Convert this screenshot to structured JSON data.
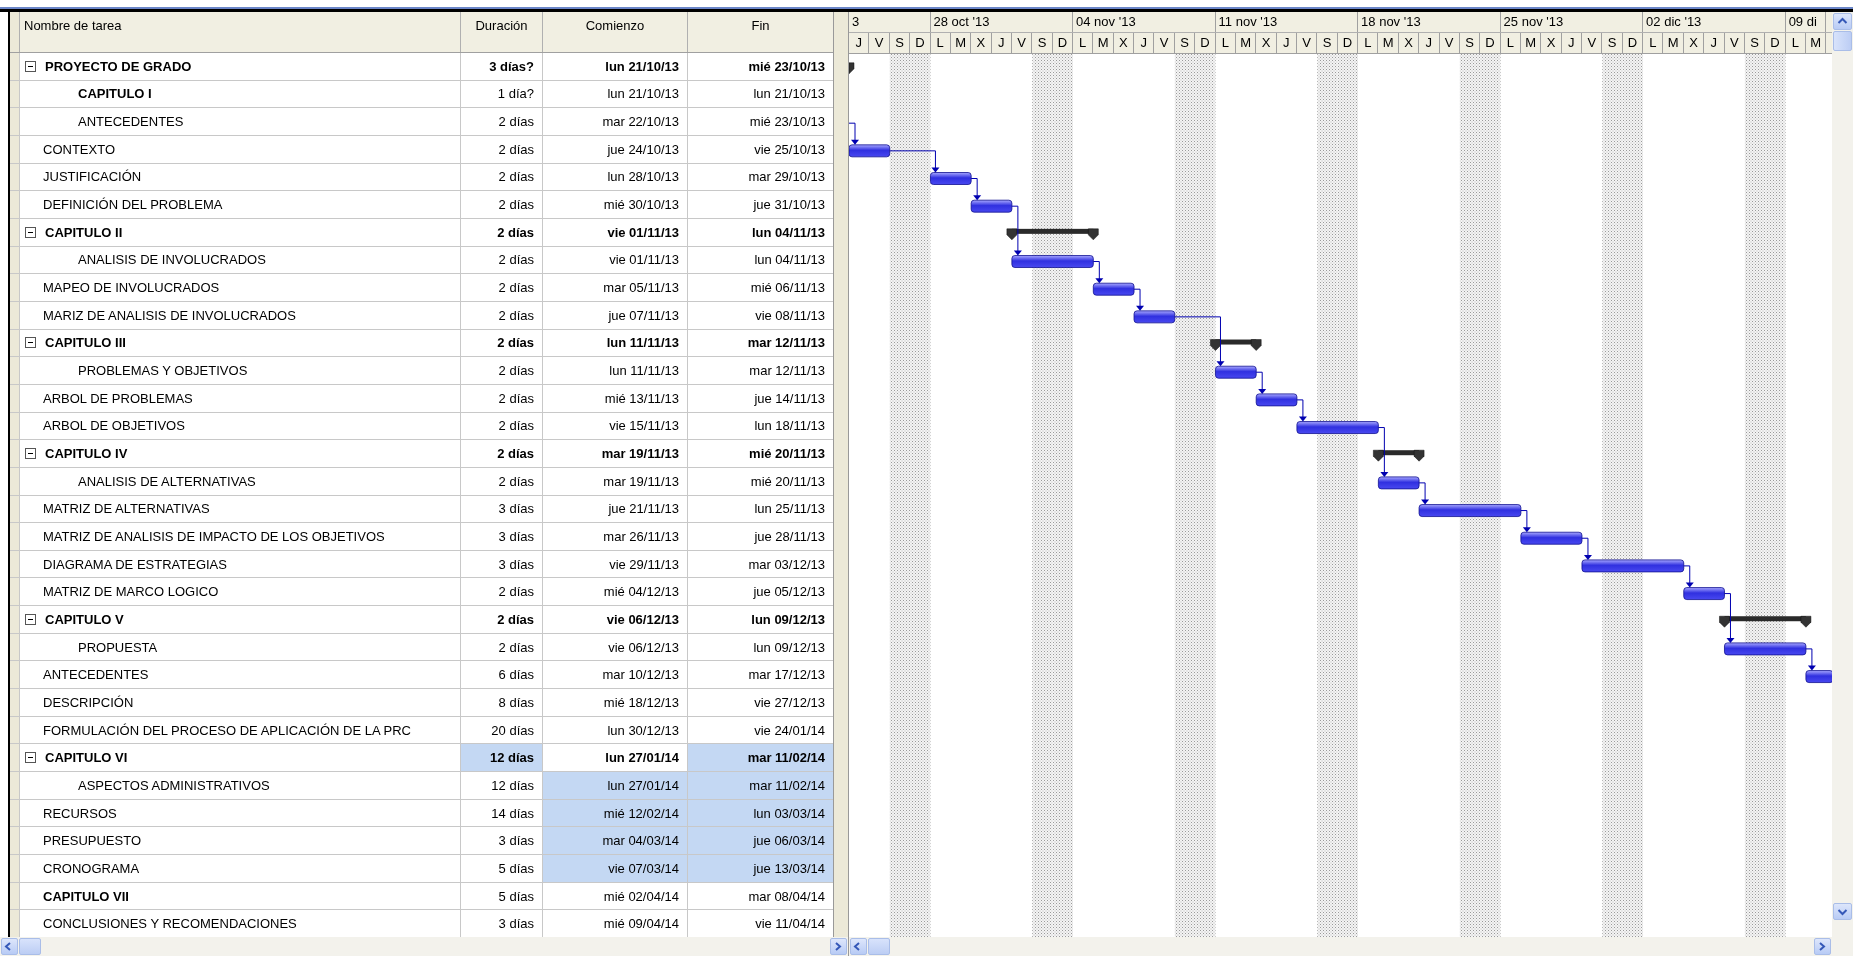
{
  "table": {
    "columns": [
      "Nombre de tarea",
      "Duración",
      "Comienzo",
      "Fin"
    ],
    "rows": [
      {
        "name": "PROYECTO DE GRADO",
        "kind": "summary",
        "expanded": true,
        "duration": "3 días?",
        "start": "lun 21/10/13",
        "finish": "mié 23/10/13",
        "predecessor_link": false,
        "duration_selected": false,
        "start_selected": false,
        "finish_selected": false,
        "children": [
          {
            "name": "CAPITULO I",
            "kind": "heading",
            "duration": "1 día?",
            "start": "lun 21/10/13",
            "finish": "lun 21/10/13",
            "predecessor_link": false,
            "duration_selected": false,
            "start_selected": false,
            "finish_selected": false
          },
          {
            "name": "ANTECEDENTES",
            "kind": "task",
            "duration": "2 días",
            "start": "mar 22/10/13",
            "finish": "mié 23/10/13",
            "predecessor_link": true,
            "duration_selected": false,
            "start_selected": false,
            "finish_selected": false
          }
        ]
      },
      {
        "name": "CONTEXTO",
        "kind": "task",
        "duration": "2 días",
        "start": "jue 24/10/13",
        "finish": "vie 25/10/13",
        "predecessor_link": true,
        "duration_selected": false,
        "start_selected": false,
        "finish_selected": false
      },
      {
        "name": "JUSTIFICACIÓN",
        "kind": "task",
        "duration": "2 días",
        "start": "lun 28/10/13",
        "finish": "mar 29/10/13",
        "predecessor_link": true,
        "duration_selected": false,
        "start_selected": false,
        "finish_selected": false
      },
      {
        "name": "DEFINICIÓN DEL PROBLEMA",
        "kind": "task",
        "duration": "2 días",
        "start": "mié 30/10/13",
        "finish": "jue 31/10/13",
        "predecessor_link": true,
        "duration_selected": false,
        "start_selected": false,
        "finish_selected": false
      },
      {
        "name": "CAPITULO II",
        "kind": "summary",
        "expanded": true,
        "duration": "2 días",
        "start": "vie 01/11/13",
        "finish": "lun 04/11/13",
        "predecessor_link": false,
        "duration_selected": false,
        "start_selected": false,
        "finish_selected": false,
        "children": [
          {
            "name": "ANALISIS DE INVOLUCRADOS",
            "kind": "task",
            "duration": "2 días",
            "start": "vie 01/11/13",
            "finish": "lun 04/11/13",
            "predecessor_link": true,
            "duration_selected": false,
            "start_selected": false,
            "finish_selected": false
          }
        ]
      },
      {
        "name": "MAPEO DE INVOLUCRADOS",
        "kind": "task",
        "duration": "2 días",
        "start": "mar 05/11/13",
        "finish": "mié 06/11/13",
        "predecessor_link": true,
        "duration_selected": false,
        "start_selected": false,
        "finish_selected": false
      },
      {
        "name": "MARIZ DE ANALISIS DE INVOLUCRADOS",
        "kind": "task",
        "duration": "2 días",
        "start": "jue 07/11/13",
        "finish": "vie 08/11/13",
        "predecessor_link": true,
        "duration_selected": false,
        "start_selected": false,
        "finish_selected": false
      },
      {
        "name": "CAPITULO III",
        "kind": "summary",
        "expanded": true,
        "duration": "2 días",
        "start": "lun 11/11/13",
        "finish": "mar 12/11/13",
        "predecessor_link": false,
        "duration_selected": false,
        "start_selected": false,
        "finish_selected": false,
        "children": [
          {
            "name": "PROBLEMAS Y OBJETIVOS",
            "kind": "task",
            "duration": "2 días",
            "start": "lun 11/11/13",
            "finish": "mar 12/11/13",
            "predecessor_link": true,
            "duration_selected": false,
            "start_selected": false,
            "finish_selected": false
          }
        ]
      },
      {
        "name": "ARBOL DE PROBLEMAS",
        "kind": "task",
        "duration": "2 días",
        "start": "mié 13/11/13",
        "finish": "jue 14/11/13",
        "predecessor_link": true,
        "duration_selected": false,
        "start_selected": false,
        "finish_selected": false
      },
      {
        "name": "ARBOL DE OBJETIVOS",
        "kind": "task",
        "duration": "2 días",
        "start": "vie 15/11/13",
        "finish": "lun 18/11/13",
        "predecessor_link": true,
        "duration_selected": false,
        "start_selected": false,
        "finish_selected": false
      },
      {
        "name": "CAPITULO IV",
        "kind": "summary",
        "expanded": true,
        "duration": "2 días",
        "start": "mar 19/11/13",
        "finish": "mié 20/11/13",
        "predecessor_link": false,
        "duration_selected": false,
        "start_selected": false,
        "finish_selected": false,
        "children": [
          {
            "name": "ANALISIS DE ALTERNATIVAS",
            "kind": "task",
            "duration": "2 días",
            "start": "mar 19/11/13",
            "finish": "mié 20/11/13",
            "predecessor_link": true,
            "duration_selected": false,
            "start_selected": false,
            "finish_selected": false
          }
        ]
      },
      {
        "name": "MATRIZ DE ALTERNATIVAS",
        "kind": "task",
        "duration": "3 días",
        "start": "jue 21/11/13",
        "finish": "lun 25/11/13",
        "predecessor_link": true,
        "duration_selected": false,
        "start_selected": false,
        "finish_selected": false
      },
      {
        "name": "MATRIZ DE ANALISIS DE IMPACTO DE LOS OBJETIVOS",
        "kind": "task",
        "duration": "3 días",
        "start": "mar 26/11/13",
        "finish": "jue 28/11/13",
        "predecessor_link": true,
        "duration_selected": false,
        "start_selected": false,
        "finish_selected": false
      },
      {
        "name": "DIAGRAMA DE ESTRATEGIAS",
        "kind": "task",
        "duration": "3 días",
        "start": "vie 29/11/13",
        "finish": "mar 03/12/13",
        "predecessor_link": true,
        "duration_selected": false,
        "start_selected": false,
        "finish_selected": false
      },
      {
        "name": "MATRIZ DE MARCO LOGICO",
        "kind": "task",
        "duration": "2 días",
        "start": "mié 04/12/13",
        "finish": "jue 05/12/13",
        "predecessor_link": true,
        "duration_selected": false,
        "start_selected": false,
        "finish_selected": false
      },
      {
        "name": "CAPITULO V",
        "kind": "summary",
        "expanded": true,
        "duration": "2 días",
        "start": "vie 06/12/13",
        "finish": "lun 09/12/13",
        "predecessor_link": false,
        "duration_selected": false,
        "start_selected": false,
        "finish_selected": false,
        "children": [
          {
            "name": "PROPUESTA",
            "kind": "task",
            "duration": "2 días",
            "start": "vie 06/12/13",
            "finish": "lun 09/12/13",
            "predecessor_link": true,
            "duration_selected": false,
            "start_selected": false,
            "finish_selected": false
          }
        ]
      },
      {
        "name": "ANTECEDENTES",
        "kind": "task",
        "duration": "6 días",
        "start": "mar 10/12/13",
        "finish": "mar 17/12/13",
        "predecessor_link": false,
        "duration_selected": false,
        "start_selected": false,
        "finish_selected": false
      },
      {
        "name": "DESCRIPCIÓN",
        "kind": "task",
        "duration": "8 días",
        "start": "mié 18/12/13",
        "finish": "vie 27/12/13",
        "predecessor_link": false,
        "duration_selected": false,
        "start_selected": false,
        "finish_selected": false
      },
      {
        "name": "FORMULACIÓN DEL PROCESO DE APLICACIÓN DE LA PRC",
        "kind": "task",
        "duration": "20 días",
        "start": "lun 30/12/13",
        "finish": "vie 24/01/14",
        "predecessor_link": false,
        "duration_selected": false,
        "start_selected": false,
        "finish_selected": false
      },
      {
        "name": "CAPITULO VI",
        "kind": "summary",
        "expanded": true,
        "duration": "12 días",
        "start": "lun 27/01/14",
        "finish": "mar 11/02/14",
        "predecessor_link": false,
        "duration_selected": true,
        "start_selected": false,
        "finish_selected": true,
        "children": [
          {
            "name": "ASPECTOS ADMINISTRATIVOS",
            "kind": "task",
            "duration": "12 días",
            "start": "lun 27/01/14",
            "finish": "mar 11/02/14",
            "predecessor_link": false,
            "duration_selected": false,
            "start_selected": true,
            "finish_selected": true
          }
        ]
      },
      {
        "name": "RECURSOS",
        "kind": "task",
        "duration": "14 días",
        "start": "mié 12/02/14",
        "finish": "lun 03/03/14",
        "predecessor_link": false,
        "duration_selected": false,
        "start_selected": true,
        "finish_selected": true
      },
      {
        "name": "PRESUPUESTO",
        "kind": "task",
        "duration": "3 días",
        "start": "mar 04/03/14",
        "finish": "jue 06/03/14",
        "predecessor_link": false,
        "duration_selected": false,
        "start_selected": true,
        "finish_selected": true
      },
      {
        "name": "CRONOGRAMA",
        "kind": "task",
        "duration": "5 días",
        "start": "vie 07/03/14",
        "finish": "jue 13/03/14",
        "predecessor_link": false,
        "duration_selected": false,
        "start_selected": true,
        "finish_selected": true
      },
      {
        "name": "CAPITULO VII",
        "kind": "heading",
        "duration": "5 días",
        "start": "mié 02/04/14",
        "finish": "mar 08/04/14",
        "predecessor_link": false,
        "duration_selected": false,
        "start_selected": false,
        "finish_selected": false
      },
      {
        "name": "CONCLUSIONES Y RECOMENDACIONES",
        "kind": "task",
        "duration": "3 días",
        "start": "mié 09/04/14",
        "finish": "vie 11/04/14",
        "predecessor_link": false,
        "duration_selected": false,
        "start_selected": false,
        "finish_selected": false
      }
    ]
  },
  "timeline": {
    "weeks": [
      {
        "label": "3",
        "days": [
          {
            "letter": "J",
            "nonworking": false
          },
          {
            "letter": "V",
            "nonworking": false
          },
          {
            "letter": "S",
            "nonworking": true
          },
          {
            "letter": "D",
            "nonworking": true
          }
        ]
      },
      {
        "label": "28 oct '13",
        "days": [
          {
            "letter": "L",
            "nonworking": false
          },
          {
            "letter": "M",
            "nonworking": false
          },
          {
            "letter": "X",
            "nonworking": false
          },
          {
            "letter": "J",
            "nonworking": false
          },
          {
            "letter": "V",
            "nonworking": false
          },
          {
            "letter": "S",
            "nonworking": true
          },
          {
            "letter": "D",
            "nonworking": true
          }
        ]
      },
      {
        "label": "04 nov '13",
        "days": [
          {
            "letter": "L",
            "nonworking": false
          },
          {
            "letter": "M",
            "nonworking": false
          },
          {
            "letter": "X",
            "nonworking": false
          },
          {
            "letter": "J",
            "nonworking": false
          },
          {
            "letter": "V",
            "nonworking": false
          },
          {
            "letter": "S",
            "nonworking": true
          },
          {
            "letter": "D",
            "nonworking": true
          }
        ]
      },
      {
        "label": "11 nov '13",
        "days": [
          {
            "letter": "L",
            "nonworking": false
          },
          {
            "letter": "M",
            "nonworking": false
          },
          {
            "letter": "X",
            "nonworking": false
          },
          {
            "letter": "J",
            "nonworking": false
          },
          {
            "letter": "V",
            "nonworking": false
          },
          {
            "letter": "S",
            "nonworking": true
          },
          {
            "letter": "D",
            "nonworking": true
          }
        ]
      },
      {
        "label": "18 nov '13",
        "days": [
          {
            "letter": "L",
            "nonworking": false
          },
          {
            "letter": "M",
            "nonworking": false
          },
          {
            "letter": "X",
            "nonworking": false
          },
          {
            "letter": "J",
            "nonworking": false
          },
          {
            "letter": "V",
            "nonworking": false
          },
          {
            "letter": "S",
            "nonworking": true
          },
          {
            "letter": "D",
            "nonworking": true
          }
        ]
      },
      {
        "label": "25 nov '13",
        "days": [
          {
            "letter": "L",
            "nonworking": false
          },
          {
            "letter": "M",
            "nonworking": false
          },
          {
            "letter": "X",
            "nonworking": false
          },
          {
            "letter": "J",
            "nonworking": false
          },
          {
            "letter": "V",
            "nonworking": false
          },
          {
            "letter": "S",
            "nonworking": true
          },
          {
            "letter": "D",
            "nonworking": true
          }
        ]
      },
      {
        "label": "02 dic '13",
        "days": [
          {
            "letter": "L",
            "nonworking": false
          },
          {
            "letter": "M",
            "nonworking": false
          },
          {
            "letter": "X",
            "nonworking": false
          },
          {
            "letter": "J",
            "nonworking": false
          },
          {
            "letter": "V",
            "nonworking": false
          },
          {
            "letter": "S",
            "nonworking": true
          },
          {
            "letter": "D",
            "nonworking": true
          }
        ]
      },
      {
        "label": "09 di",
        "days": [
          {
            "letter": "L",
            "nonworking": false
          },
          {
            "letter": "M",
            "nonworking": false
          }
        ]
      }
    ]
  }
}
